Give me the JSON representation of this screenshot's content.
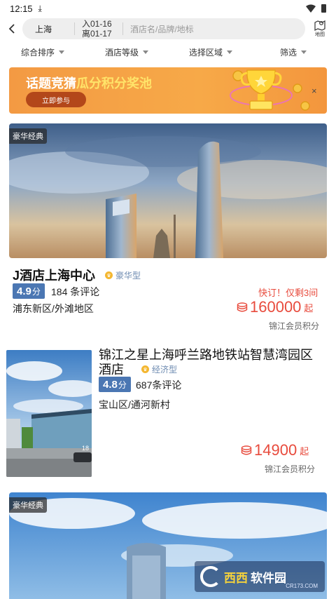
{
  "status": {
    "time": "12:15"
  },
  "search": {
    "city": "上海",
    "checkin": "入01-16",
    "checkout": "离01-17",
    "placeholder": "酒店名/品牌/地标",
    "map_label": "地图"
  },
  "filters": [
    {
      "label": "综合排序"
    },
    {
      "label": "酒店等级"
    },
    {
      "label": "选择区域"
    },
    {
      "label": "筛选"
    }
  ],
  "banner": {
    "title_plain": "话题竞猜",
    "title_highlight": "瓜分积分奖池",
    "button": "立即参与",
    "close": "×"
  },
  "hotels": [
    {
      "tag": "豪华经典",
      "name": "J酒店上海中心",
      "type": "豪华型",
      "score": "4.9",
      "score_unit": "分",
      "reviews": "184 条评论",
      "area": "浦东新区/外滩地区",
      "urgent": "快订！仅剩3间",
      "price": "160000",
      "price_unit": "起",
      "member": "锦江会员积分"
    },
    {
      "name": "锦江之星上海呼兰路地铁站智慧湾园区酒店",
      "type": "经济型",
      "score": "4.8",
      "score_unit": "分",
      "reviews": "687条评论",
      "area": "宝山区/通河新村",
      "price": "14900",
      "price_unit": "起",
      "member": "锦江会员积分"
    },
    {
      "tag": "豪华经典"
    }
  ],
  "watermark": {
    "brand_a": "西西",
    "brand_b": "软件园",
    "site": "CR173.COM"
  },
  "colors": {
    "price": "#e84b3d",
    "score_bg": "#4b77b3",
    "banner": "#f7a948"
  }
}
